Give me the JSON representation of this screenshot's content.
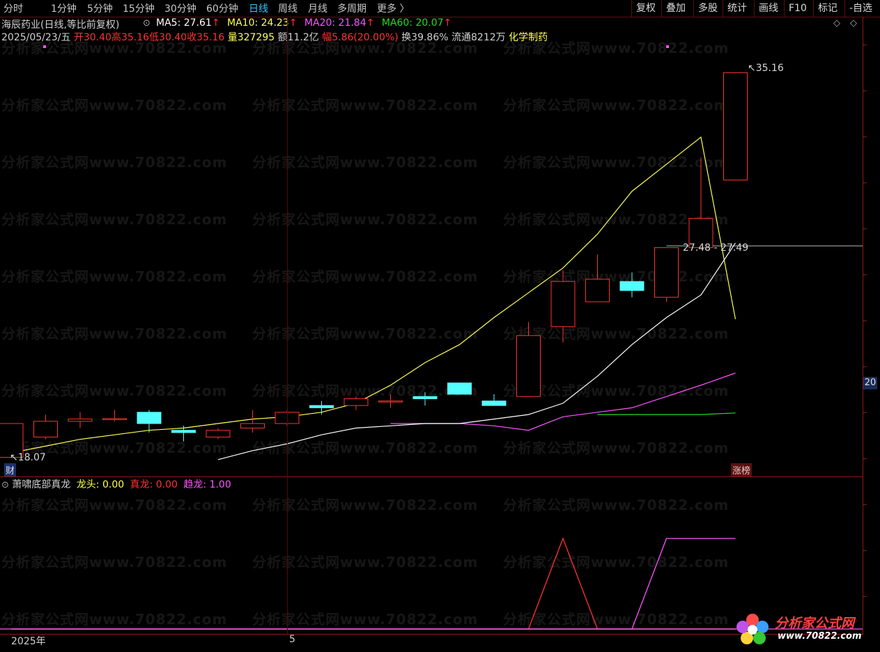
{
  "toolbar": {
    "periods": [
      "分时",
      "1分钟",
      "5分钟",
      "15分钟",
      "30分钟",
      "60分钟",
      "日线",
      "周线",
      "月线",
      "多周期",
      "更多 〉"
    ],
    "active_period": "日线",
    "buttons": [
      "复权",
      "叠加",
      "多股",
      "统计",
      "画线",
      "F10",
      "标记",
      "-自选"
    ]
  },
  "header": {
    "title": "海辰药业(日线,等比前复权)",
    "ma5_label": "MA5: 27.61",
    "ma10_label": "MA10: 24.23",
    "ma20_label": "MA20: 21.84",
    "ma60_label": "MA60: 20.07",
    "up_arrow": "↑",
    "date": "2025/05/23/五",
    "open": "开30.40",
    "high": "高35.16",
    "low": "低30.40",
    "close": "收35.16",
    "volume": "量327295",
    "amount": "额11.2亿",
    "change": "幅5.86(20.00%)",
    "turnover": "换39.86%",
    "float": "流通8212万",
    "industry": "化学制药",
    "diamond": "◇",
    "expand": "◇"
  },
  "indicator": {
    "name": "萧啸底部真龙",
    "longtou_label": "龙头: 0.00",
    "zhenlong_label": "真龙: 0.00",
    "qulong_label": "趋龙: 1.00"
  },
  "markers": {
    "high_label": "35.16",
    "low_label": "18.07",
    "cross_label": "27.48 - 27.49",
    "axis_badge": "20",
    "cai_badge": "财",
    "zhangbang_badge": "涨榜"
  },
  "xaxis": {
    "year_label": "2025年",
    "month_label": "5"
  },
  "logo": {
    "name": "分析家公式网",
    "url": "www.70822.com"
  },
  "watermark": "分析家公式网www.70822.com",
  "colors": {
    "up": "#ff3232",
    "down": "#54ffff",
    "ma5": "#ffffff",
    "ma10": "#ffff54",
    "ma20": "#ff54ff",
    "ma60": "#22dd22",
    "zhenlong": "#ff3232",
    "qulong": "#ff54ff"
  },
  "chart_data": [
    {
      "type": "candlestick",
      "title": "海辰药业(日线,等比前复权)",
      "series_name": "price",
      "candles": [
        {
          "o": 18.1,
          "h": 19.6,
          "l": 18.07,
          "c": 19.6
        },
        {
          "o": 19.0,
          "h": 20.0,
          "l": 18.9,
          "c": 19.7
        },
        {
          "o": 19.7,
          "h": 20.1,
          "l": 19.4,
          "c": 19.8
        },
        {
          "o": 19.8,
          "h": 20.2,
          "l": 19.7,
          "c": 19.82
        },
        {
          "o": 20.1,
          "h": 20.2,
          "l": 19.2,
          "c": 19.6
        },
        {
          "o": 19.3,
          "h": 19.5,
          "l": 18.8,
          "c": 19.2
        },
        {
          "o": 19.0,
          "h": 19.4,
          "l": 18.9,
          "c": 19.3
        },
        {
          "o": 19.4,
          "h": 20.2,
          "l": 19.2,
          "c": 19.6
        },
        {
          "o": 19.6,
          "h": 20.2,
          "l": 19.5,
          "c": 20.1
        },
        {
          "o": 20.4,
          "h": 20.6,
          "l": 20.0,
          "c": 20.3
        },
        {
          "o": 20.4,
          "h": 20.8,
          "l": 20.2,
          "c": 20.7
        },
        {
          "o": 20.6,
          "h": 20.9,
          "l": 20.3,
          "c": 20.6
        },
        {
          "o": 20.8,
          "h": 21.0,
          "l": 20.4,
          "c": 20.7
        },
        {
          "o": 21.4,
          "h": 21.4,
          "l": 20.9,
          "c": 20.9
        },
        {
          "o": 20.6,
          "h": 20.9,
          "l": 20.4,
          "c": 20.4
        },
        {
          "o": 20.8,
          "h": 24.1,
          "l": 20.8,
          "c": 23.5
        },
        {
          "o": 23.9,
          "h": 26.4,
          "l": 23.2,
          "c": 25.9
        },
        {
          "o": 25.0,
          "h": 27.1,
          "l": 25.0,
          "c": 26.0
        },
        {
          "o": 25.9,
          "h": 26.3,
          "l": 25.2,
          "c": 25.5
        },
        {
          "o": 25.2,
          "h": 27.4,
          "l": 25.0,
          "c": 27.4
        },
        {
          "o": 27.4,
          "h": 31.4,
          "l": 27.4,
          "c": 28.7
        },
        {
          "o": 30.4,
          "h": 35.16,
          "l": 30.4,
          "c": 35.16
        }
      ],
      "ma5": [
        18.0,
        18.4,
        18.7,
        19.1,
        19.4,
        19.5,
        19.6,
        19.6,
        19.8,
        20.0,
        20.5,
        21.7,
        23.1,
        24.3,
        25.3,
        27.61
      ],
      "ma10": [
        18.3,
        18.6,
        18.9,
        19.1,
        19.3,
        19.4,
        19.6,
        19.8,
        19.9,
        20.1,
        20.5,
        21.3,
        22.3,
        23.1,
        24.3,
        25.4,
        26.5,
        28.0,
        29.9,
        31.1,
        32.3,
        24.23
      ],
      "ma20": [
        19.6,
        19.6,
        19.6,
        19.5,
        19.3,
        19.9,
        20.1,
        20.3,
        20.8,
        21.3,
        21.84
      ],
      "ma60": [
        20.0,
        20.0,
        20.0,
        20.0,
        20.07
      ],
      "ylim": [
        17.5,
        36.5
      ]
    },
    {
      "type": "line",
      "title": "萧啸底部真龙",
      "series": [
        {
          "name": "龙头",
          "values": [
            0,
            0,
            0,
            0,
            0,
            0,
            0,
            0,
            0,
            0,
            0,
            0,
            0,
            0,
            0,
            0,
            0,
            0,
            0,
            0,
            0,
            0
          ]
        },
        {
          "name": "真龙",
          "values": [
            0,
            0,
            0,
            0,
            0,
            0,
            0,
            0,
            0,
            0,
            0,
            0,
            0,
            0,
            0,
            0,
            1,
            0,
            0,
            0,
            0,
            0
          ]
        },
        {
          "name": "趋龙",
          "values": [
            0,
            0,
            0,
            0,
            0,
            0,
            0,
            0,
            0,
            0,
            0,
            0,
            0,
            0,
            0,
            0,
            0,
            0,
            0,
            1,
            1,
            1
          ]
        }
      ],
      "ylim": [
        0,
        1.5
      ]
    }
  ]
}
